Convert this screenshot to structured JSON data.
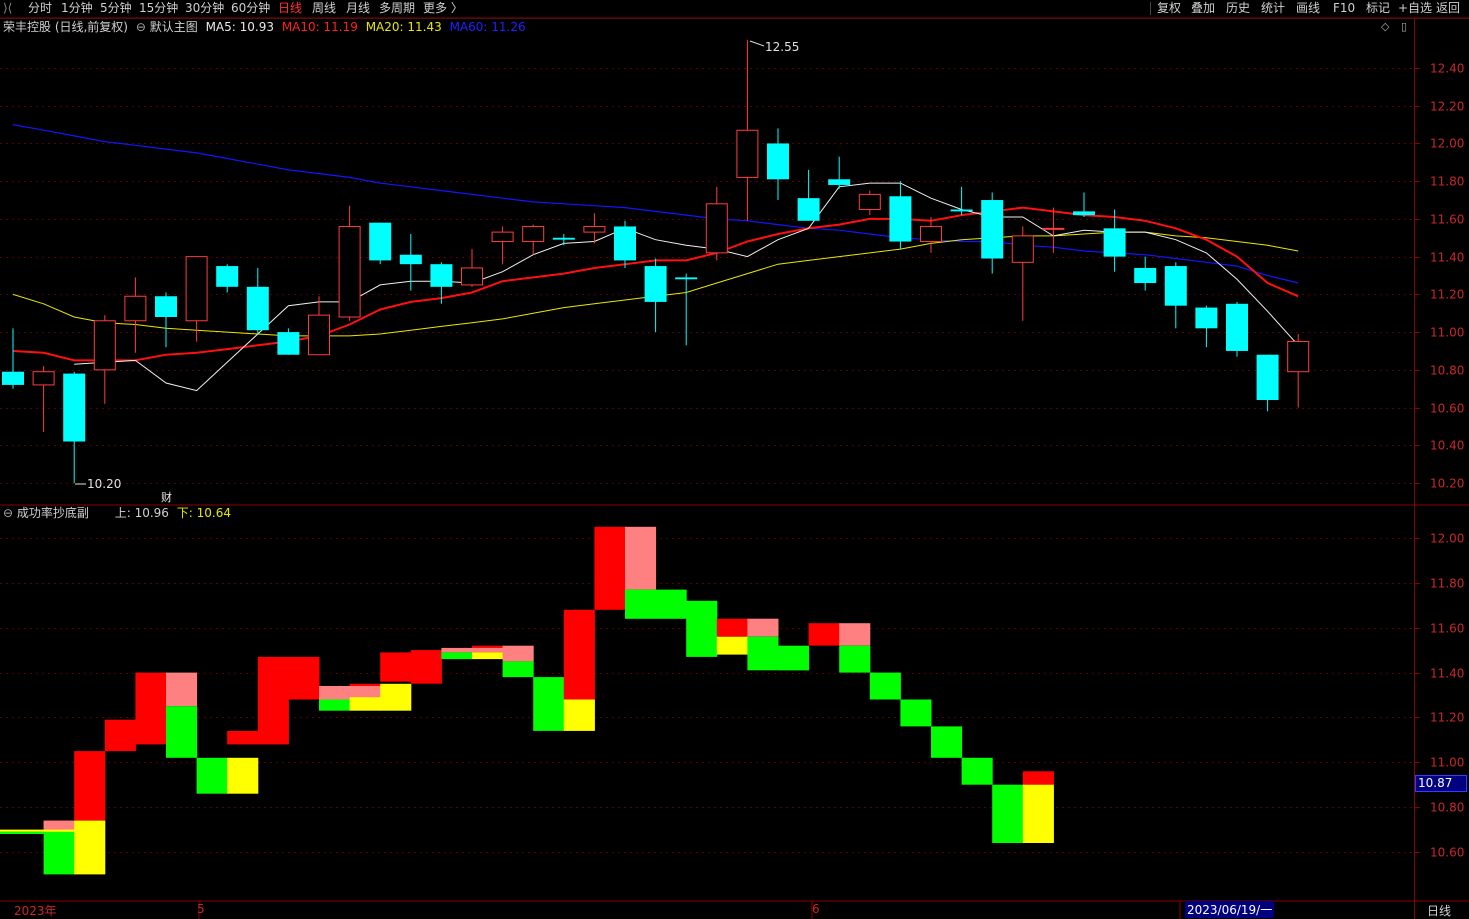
{
  "toolbar": {
    "periods": [
      "分时",
      "1分钟",
      "5分钟",
      "15分钟",
      "30分钟",
      "60分钟",
      "日线",
      "周线",
      "月线",
      "多周期",
      "更多 〉"
    ],
    "active_period": "日线",
    "right_buttons": [
      "复权",
      "叠加",
      "历史",
      "统计",
      "画线",
      "F10",
      "标记",
      "+自选",
      "返回"
    ]
  },
  "main_panel": {
    "title": "荣丰控股 (日线,前复权)",
    "indicator_name": "默认主图",
    "ma": [
      {
        "label": "MA5: 10.93",
        "color": "#e8e8e8"
      },
      {
        "label": "MA10: 11.19",
        "color": "#ff2020"
      },
      {
        "label": "MA20: 11.43",
        "color": "#e8e800"
      },
      {
        "label": "MA60: 11.26",
        "color": "#2020ff"
      }
    ],
    "high_label": "12.55",
    "low_label": "10.20",
    "fin_marker": "财",
    "y_ticks": [
      "12.40",
      "12.20",
      "12.00",
      "11.80",
      "11.60",
      "11.40",
      "11.20",
      "11.00",
      "10.80",
      "10.60",
      "10.40",
      "10.20"
    ]
  },
  "sub_panel": {
    "indicator_name": "成功率抄底副",
    "upper_label": "上: 10.96",
    "lower_label": "下: 10.64",
    "y_ticks": [
      "12.00",
      "11.80",
      "11.60",
      "11.40",
      "11.20",
      "11.00",
      "10.80",
      "10.60"
    ],
    "current_value": "10.87"
  },
  "date_axis": {
    "labels": [
      "2023年",
      "5",
      "6"
    ],
    "cursor_date": "2023/06/19/一",
    "period_label": "日线"
  },
  "colors": {
    "up": "#ff3c3c",
    "down": "#00ffff",
    "red": "#ff0000",
    "pink": "#ff8080",
    "green": "#00ff00",
    "yellow": "#ffff00",
    "blue": "#1414ff"
  },
  "chart_data": {
    "type": "candlestick",
    "y_range": [
      10.12,
      12.52
    ],
    "candles": [
      {
        "o": 10.79,
        "h": 11.02,
        "l": 10.7,
        "c": 10.72
      },
      {
        "o": 10.72,
        "h": 10.82,
        "l": 10.47,
        "c": 10.79
      },
      {
        "o": 10.78,
        "h": 10.79,
        "l": 10.2,
        "c": 10.42
      },
      {
        "o": 10.8,
        "h": 11.09,
        "l": 10.62,
        "c": 11.06
      },
      {
        "o": 11.06,
        "h": 11.29,
        "l": 10.89,
        "c": 11.19
      },
      {
        "o": 11.19,
        "h": 11.21,
        "l": 10.92,
        "c": 11.08
      },
      {
        "o": 11.06,
        "h": 11.39,
        "l": 10.95,
        "c": 11.4
      },
      {
        "o": 11.35,
        "h": 11.36,
        "l": 11.21,
        "c": 11.24
      },
      {
        "o": 11.24,
        "h": 11.34,
        "l": 10.99,
        "c": 11.01
      },
      {
        "o": 11.0,
        "h": 11.02,
        "l": 10.88,
        "c": 10.88
      },
      {
        "o": 10.88,
        "h": 11.19,
        "l": 10.88,
        "c": 11.09
      },
      {
        "o": 11.08,
        "h": 11.67,
        "l": 11.06,
        "c": 11.56
      },
      {
        "o": 11.58,
        "h": 11.58,
        "l": 11.36,
        "c": 11.38
      },
      {
        "o": 11.41,
        "h": 11.52,
        "l": 11.22,
        "c": 11.36
      },
      {
        "o": 11.36,
        "h": 11.37,
        "l": 11.15,
        "c": 11.24
      },
      {
        "o": 11.25,
        "h": 11.44,
        "l": 11.24,
        "c": 11.34
      },
      {
        "o": 11.48,
        "h": 11.56,
        "l": 11.36,
        "c": 11.53
      },
      {
        "o": 11.48,
        "h": 11.57,
        "l": 11.41,
        "c": 11.56
      },
      {
        "o": 11.5,
        "h": 11.52,
        "l": 11.46,
        "c": 11.49
      },
      {
        "o": 11.53,
        "h": 11.63,
        "l": 11.47,
        "c": 11.56
      },
      {
        "o": 11.56,
        "h": 11.59,
        "l": 11.34,
        "c": 11.38
      },
      {
        "o": 11.35,
        "h": 11.39,
        "l": 11.0,
        "c": 11.16
      },
      {
        "o": 11.29,
        "h": 11.31,
        "l": 10.93,
        "c": 11.28
      },
      {
        "o": 11.42,
        "h": 11.77,
        "l": 11.38,
        "c": 11.68
      },
      {
        "o": 11.82,
        "h": 12.55,
        "l": 11.59,
        "c": 12.07
      },
      {
        "o": 12.0,
        "h": 12.08,
        "l": 11.7,
        "c": 11.81
      },
      {
        "o": 11.71,
        "h": 11.86,
        "l": 11.62,
        "c": 11.59
      },
      {
        "o": 11.81,
        "h": 11.93,
        "l": 11.76,
        "c": 11.78
      },
      {
        "o": 11.65,
        "h": 11.75,
        "l": 11.62,
        "c": 11.73
      },
      {
        "o": 11.72,
        "h": 11.8,
        "l": 11.44,
        "c": 11.48
      },
      {
        "o": 11.48,
        "h": 11.61,
        "l": 11.42,
        "c": 11.56
      },
      {
        "o": 11.65,
        "h": 11.77,
        "l": 11.62,
        "c": 11.64
      },
      {
        "o": 11.7,
        "h": 11.74,
        "l": 11.31,
        "c": 11.39
      },
      {
        "o": 11.37,
        "h": 11.56,
        "l": 11.06,
        "c": 11.51
      },
      {
        "o": 11.55,
        "h": 11.66,
        "l": 11.42,
        "c": 11.55
      },
      {
        "o": 11.64,
        "h": 11.74,
        "l": 11.61,
        "c": 11.62
      },
      {
        "o": 11.55,
        "h": 11.65,
        "l": 11.32,
        "c": 11.4
      },
      {
        "o": 11.34,
        "h": 11.4,
        "l": 11.22,
        "c": 11.26
      },
      {
        "o": 11.35,
        "h": 11.37,
        "l": 11.02,
        "c": 11.14
      },
      {
        "o": 11.13,
        "h": 11.14,
        "l": 10.92,
        "c": 11.02
      },
      {
        "o": 11.15,
        "h": 11.16,
        "l": 10.87,
        "c": 10.9
      },
      {
        "o": 10.88,
        "h": 10.88,
        "l": 10.58,
        "c": 10.64
      },
      {
        "o": 10.79,
        "h": 10.99,
        "l": 10.6,
        "c": 10.95
      }
    ],
    "ma5": [
      null,
      null,
      10.83,
      10.84,
      10.85,
      10.73,
      10.69,
      10.84,
      10.99,
      11.14,
      11.16,
      11.16,
      11.25,
      11.27,
      11.27,
      11.26,
      11.32,
      11.41,
      11.47,
      11.48,
      11.55,
      11.49,
      11.46,
      11.44,
      11.4,
      11.49,
      11.55,
      11.77,
      11.79,
      11.79,
      11.71,
      11.65,
      11.61,
      11.61,
      11.51,
      11.54,
      11.53,
      11.53,
      11.49,
      11.42,
      11.28,
      11.11,
      10.93
    ],
    "ma10": [
      10.9,
      10.89,
      10.85,
      10.85,
      10.85,
      10.88,
      10.89,
      10.91,
      10.93,
      10.95,
      10.98,
      11.04,
      11.12,
      11.16,
      11.18,
      11.21,
      11.27,
      11.29,
      11.31,
      11.34,
      11.36,
      11.38,
      11.38,
      11.42,
      11.48,
      11.52,
      11.55,
      11.57,
      11.6,
      11.6,
      11.59,
      11.62,
      11.64,
      11.66,
      11.64,
      11.62,
      11.61,
      11.59,
      11.55,
      11.49,
      11.4,
      11.26,
      11.19
    ],
    "ma20": [
      11.2,
      11.15,
      11.08,
      11.05,
      11.04,
      11.02,
      11.01,
      11.0,
      10.99,
      10.98,
      10.98,
      10.98,
      10.99,
      11.01,
      11.03,
      11.05,
      11.07,
      11.1,
      11.13,
      11.15,
      11.17,
      11.19,
      11.21,
      11.26,
      11.31,
      11.36,
      11.38,
      11.4,
      11.42,
      11.44,
      11.47,
      11.49,
      11.5,
      11.51,
      11.51,
      11.52,
      11.53,
      11.53,
      11.51,
      11.5,
      11.48,
      11.46,
      11.43
    ],
    "ma60": [
      12.1,
      12.07,
      12.04,
      12.01,
      11.99,
      11.97,
      11.95,
      11.92,
      11.89,
      11.86,
      11.84,
      11.82,
      11.79,
      11.77,
      11.75,
      11.73,
      11.71,
      11.69,
      11.68,
      11.67,
      11.66,
      11.64,
      11.62,
      11.6,
      11.59,
      11.57,
      11.55,
      11.54,
      11.52,
      11.5,
      11.49,
      11.48,
      11.48,
      11.46,
      11.45,
      11.43,
      11.42,
      11.41,
      11.39,
      11.37,
      11.35,
      11.3,
      11.26
    ],
    "sub_indicator": {
      "y_range": [
        10.44,
        12.07
      ],
      "blocks": [
        [
          [
            10.68,
            10.69,
            "green"
          ],
          [
            10.69,
            10.7,
            "yellow"
          ]
        ],
        [
          [
            10.7,
            10.74,
            "red"
          ],
          [
            10.69,
            10.74,
            "pink"
          ],
          [
            10.5,
            10.69,
            "green"
          ],
          [
            10.69,
            10.7,
            "yellow"
          ]
        ],
        [
          [
            10.74,
            11.05,
            "red"
          ],
          [
            10.5,
            10.74,
            "yellow"
          ]
        ],
        [
          [
            11.05,
            11.19,
            "red"
          ]
        ],
        [
          [
            11.08,
            11.4,
            "red"
          ]
        ],
        [
          [
            11.25,
            11.4,
            "pink"
          ],
          [
            11.02,
            11.25,
            "green"
          ]
        ],
        [
          [
            10.86,
            11.02,
            "green"
          ]
        ],
        [
          [
            11.08,
            11.14,
            "red"
          ],
          [
            10.86,
            11.02,
            "yellow"
          ]
        ],
        [
          [
            11.08,
            11.47,
            "red"
          ]
        ],
        [
          [
            11.28,
            11.47,
            "red"
          ]
        ],
        [
          [
            11.28,
            11.34,
            "pink"
          ],
          [
            11.23,
            11.28,
            "green"
          ]
        ],
        [
          [
            11.34,
            11.35,
            "red"
          ],
          [
            11.28,
            11.34,
            "pink"
          ],
          [
            11.23,
            11.29,
            "yellow"
          ]
        ],
        [
          [
            11.36,
            11.49,
            "red"
          ],
          [
            11.23,
            11.35,
            "yellow"
          ]
        ],
        [
          [
            11.35,
            11.5,
            "red"
          ]
        ],
        [
          [
            11.49,
            11.51,
            "pink"
          ],
          [
            11.46,
            11.49,
            "green"
          ]
        ],
        [
          [
            11.51,
            11.52,
            "red"
          ],
          [
            11.49,
            11.51,
            "pink"
          ],
          [
            11.46,
            11.49,
            "yellow"
          ]
        ],
        [
          [
            11.45,
            11.52,
            "pink"
          ],
          [
            11.38,
            11.45,
            "green"
          ]
        ],
        [
          [
            11.14,
            11.38,
            "green"
          ]
        ],
        [
          [
            11.28,
            11.68,
            "red"
          ],
          [
            11.14,
            11.28,
            "yellow"
          ]
        ],
        [
          [
            11.68,
            12.05,
            "red"
          ]
        ],
        [
          [
            11.77,
            12.05,
            "pink"
          ],
          [
            11.64,
            11.77,
            "green"
          ]
        ],
        [
          [
            11.64,
            11.77,
            "green"
          ]
        ],
        [
          [
            11.47,
            11.72,
            "green"
          ]
        ],
        [
          [
            11.56,
            11.64,
            "red"
          ],
          [
            11.48,
            11.56,
            "yellow"
          ]
        ],
        [
          [
            11.56,
            11.64,
            "pink"
          ],
          [
            11.41,
            11.56,
            "green"
          ]
        ],
        [
          [
            11.41,
            11.52,
            "green"
          ]
        ],
        [
          [
            11.52,
            11.62,
            "red"
          ]
        ],
        [
          [
            11.52,
            11.62,
            "pink"
          ],
          [
            11.4,
            11.52,
            "green"
          ]
        ],
        [
          [
            11.28,
            11.4,
            "green"
          ]
        ],
        [
          [
            11.16,
            11.28,
            "green"
          ]
        ],
        [
          [
            11.02,
            11.16,
            "green"
          ]
        ],
        [
          [
            10.9,
            11.02,
            "green"
          ]
        ],
        [
          [
            10.64,
            10.9,
            "green"
          ]
        ],
        [
          [
            10.9,
            10.96,
            "red"
          ],
          [
            10.64,
            10.9,
            "yellow"
          ]
        ]
      ]
    }
  }
}
